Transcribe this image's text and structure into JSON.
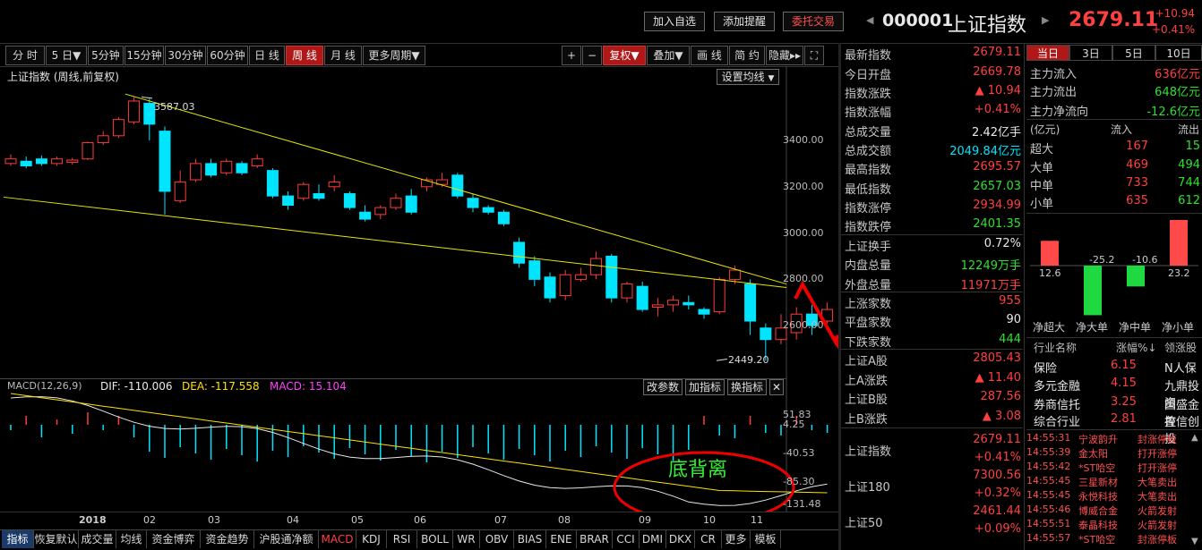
{
  "header": {
    "buttons": [
      "加入自选",
      "添加提醒",
      "委托交易"
    ],
    "code": "000001",
    "name": "上证指数",
    "price": "2679.11",
    "change": "+10.94",
    "change_pct": "+0.41%"
  },
  "period_tabs": [
    "分 时",
    "5 日▼",
    "5分钟",
    "15分钟",
    "30分钟",
    "60分钟",
    "日 线",
    "周 线",
    "月 线",
    "更多周期▼"
  ],
  "active_tab": "周 线",
  "tool_tabs": [
    "+",
    "−",
    "复权▼",
    "叠加▼",
    "画 线",
    "简 约",
    "隐藏▸▸",
    "⛶"
  ],
  "chart_title": "上证指数 (周线,前复权)",
  "ma_button": "设置均线",
  "kline": {
    "y_labels": [
      "3400.00",
      "3200.00",
      "3000.00",
      "2800.00",
      "2600.00"
    ],
    "high_label": "3587.03",
    "low_label": "2449.20",
    "x_labels": [
      "2018",
      "02",
      "03",
      "04",
      "05",
      "06",
      "07",
      "08",
      "09",
      "10",
      "11"
    ]
  },
  "macd": {
    "title": "MACD(12,26,9)",
    "dif_label": "DIF: -110.006",
    "dea_label": "DEA: -117.558",
    "macd_label": "MACD: 15.104",
    "buttons": [
      "改参数",
      "加指标",
      "换指标",
      "✕"
    ],
    "y_labels": [
      "51.83",
      "4.25",
      "-40.53",
      "-85.30",
      "-131.48"
    ],
    "annotation": "底背离"
  },
  "stats": [
    {
      "k": "最新指数",
      "v": "2679.11",
      "c": "red"
    },
    {
      "k": "今日开盘",
      "v": "2669.78",
      "c": "red"
    },
    {
      "k": "指数涨跌",
      "v": "▲ 10.94",
      "c": "red"
    },
    {
      "k": "指数涨幅",
      "v": "+0.41%",
      "c": "red"
    },
    {
      "k": "总成交量",
      "v": "2.42亿手",
      "c": "wht"
    },
    {
      "k": "总成交额",
      "v": "2049.84亿元",
      "c": "cyn"
    },
    {
      "k": "最高指数",
      "v": "2695.57",
      "c": "red"
    },
    {
      "k": "最低指数",
      "v": "2657.03",
      "c": "grn"
    },
    {
      "k": "指数涨停",
      "v": "2934.99",
      "c": "red"
    },
    {
      "k": "指数跌停",
      "v": "2401.35",
      "c": "grn"
    },
    {
      "k": "上证换手",
      "v": "0.72%",
      "c": "wht"
    },
    {
      "k": "内盘总量",
      "v": "12249万手",
      "c": "grn"
    },
    {
      "k": "外盘总量",
      "v": "11971万手",
      "c": "red"
    },
    {
      "k": "上涨家数",
      "v": "955",
      "c": "red"
    },
    {
      "k": "平盘家数",
      "v": "90",
      "c": "wht"
    },
    {
      "k": "下跌家数",
      "v": "444",
      "c": "grn"
    },
    {
      "k": "上证A股",
      "v": "2805.43",
      "c": "red"
    },
    {
      "k": "上A涨跌",
      "v": "▲ 11.40",
      "c": "red"
    },
    {
      "k": "上证B股",
      "v": "287.56",
      "c": "red"
    },
    {
      "k": "上B涨跌",
      "v": "▲ 3.08",
      "c": "red"
    }
  ],
  "indices": [
    {
      "k": "上证指数",
      "v1": "2679.11",
      "v2": "+0.41%"
    },
    {
      "k": "上证180",
      "v1": "7300.56",
      "v2": "+0.32%"
    },
    {
      "k": "上证50",
      "v1": "2461.44",
      "v2": "+0.09%"
    }
  ],
  "flow_tabs": [
    "当日",
    "3日",
    "5日",
    "10日"
  ],
  "flow": [
    {
      "k": "主力流入",
      "v": "636亿元",
      "c": "red"
    },
    {
      "k": "主力流出",
      "v": "648亿元",
      "c": "grn"
    },
    {
      "k": "主力净流向",
      "v": "-12.6亿元",
      "c": "grn"
    }
  ],
  "flow_table": {
    "unit": "(亿元)",
    "in": "流入",
    "out": "流出",
    "rows": [
      {
        "k": "超大",
        "in": "167",
        "out": "15"
      },
      {
        "k": "大单",
        "in": "469",
        "out": "494"
      },
      {
        "k": "中单",
        "in": "733",
        "out": "744"
      },
      {
        "k": "小单",
        "in": "635",
        "out": "612"
      }
    ]
  },
  "net_bars": {
    "values": [
      12.6,
      -25.2,
      -10.6,
      23.2
    ],
    "labels": [
      "12.6",
      "-25.2",
      "-10.6",
      "23.2"
    ],
    "names": [
      "净超大",
      "净大单",
      "净中单",
      "净小单"
    ]
  },
  "industry": {
    "headers": [
      "行业名称",
      "涨幅%↓",
      "领涨股"
    ],
    "rows": [
      {
        "name": "保险",
        "pct": "6.15",
        "lead": "N人保"
      },
      {
        "name": "多元金融",
        "pct": "4.15",
        "lead": "九鼎投资"
      },
      {
        "name": "券商信托",
        "pct": "3.25",
        "lead": "国盛金控"
      },
      {
        "name": "综合行业",
        "pct": "2.81",
        "lead": "鲁信创投"
      }
    ]
  },
  "feed": [
    {
      "t": "14:55:31",
      "s": "宁波韵升",
      "e": "封涨停板"
    },
    {
      "t": "14:55:39",
      "s": "金太阳",
      "e": "打开涨停"
    },
    {
      "t": "14:55:42",
      "s": "*ST哈空",
      "e": "打开涨停"
    },
    {
      "t": "14:55:45",
      "s": "三星新材",
      "e": "大笔卖出"
    },
    {
      "t": "14:55:45",
      "s": "永悦科技",
      "e": "大笔卖出"
    },
    {
      "t": "14:55:46",
      "s": "博威合金",
      "e": "火箭发射"
    },
    {
      "t": "14:55:51",
      "s": "泰晶科技",
      "e": "火箭发射"
    },
    {
      "t": "14:55:57",
      "s": "*ST哈空",
      "e": "封涨停板"
    }
  ],
  "bottom_tabs": [
    "指标",
    "恢复默认",
    "成交量",
    "均线",
    "资金博弈",
    "资金趋势",
    "沪股通净额",
    "MACD",
    "KDJ",
    "RSI",
    "BOLL",
    "WR",
    "OBV",
    "BIAS",
    "ENE",
    "BRAR",
    "CCI",
    "DMI",
    "DKX",
    "CR",
    "更多",
    "模板"
  ],
  "colors": {
    "up": "#ff3b3b",
    "down": "#00e5ff",
    "trend": "#e6e600",
    "accent": "#b01818"
  }
}
